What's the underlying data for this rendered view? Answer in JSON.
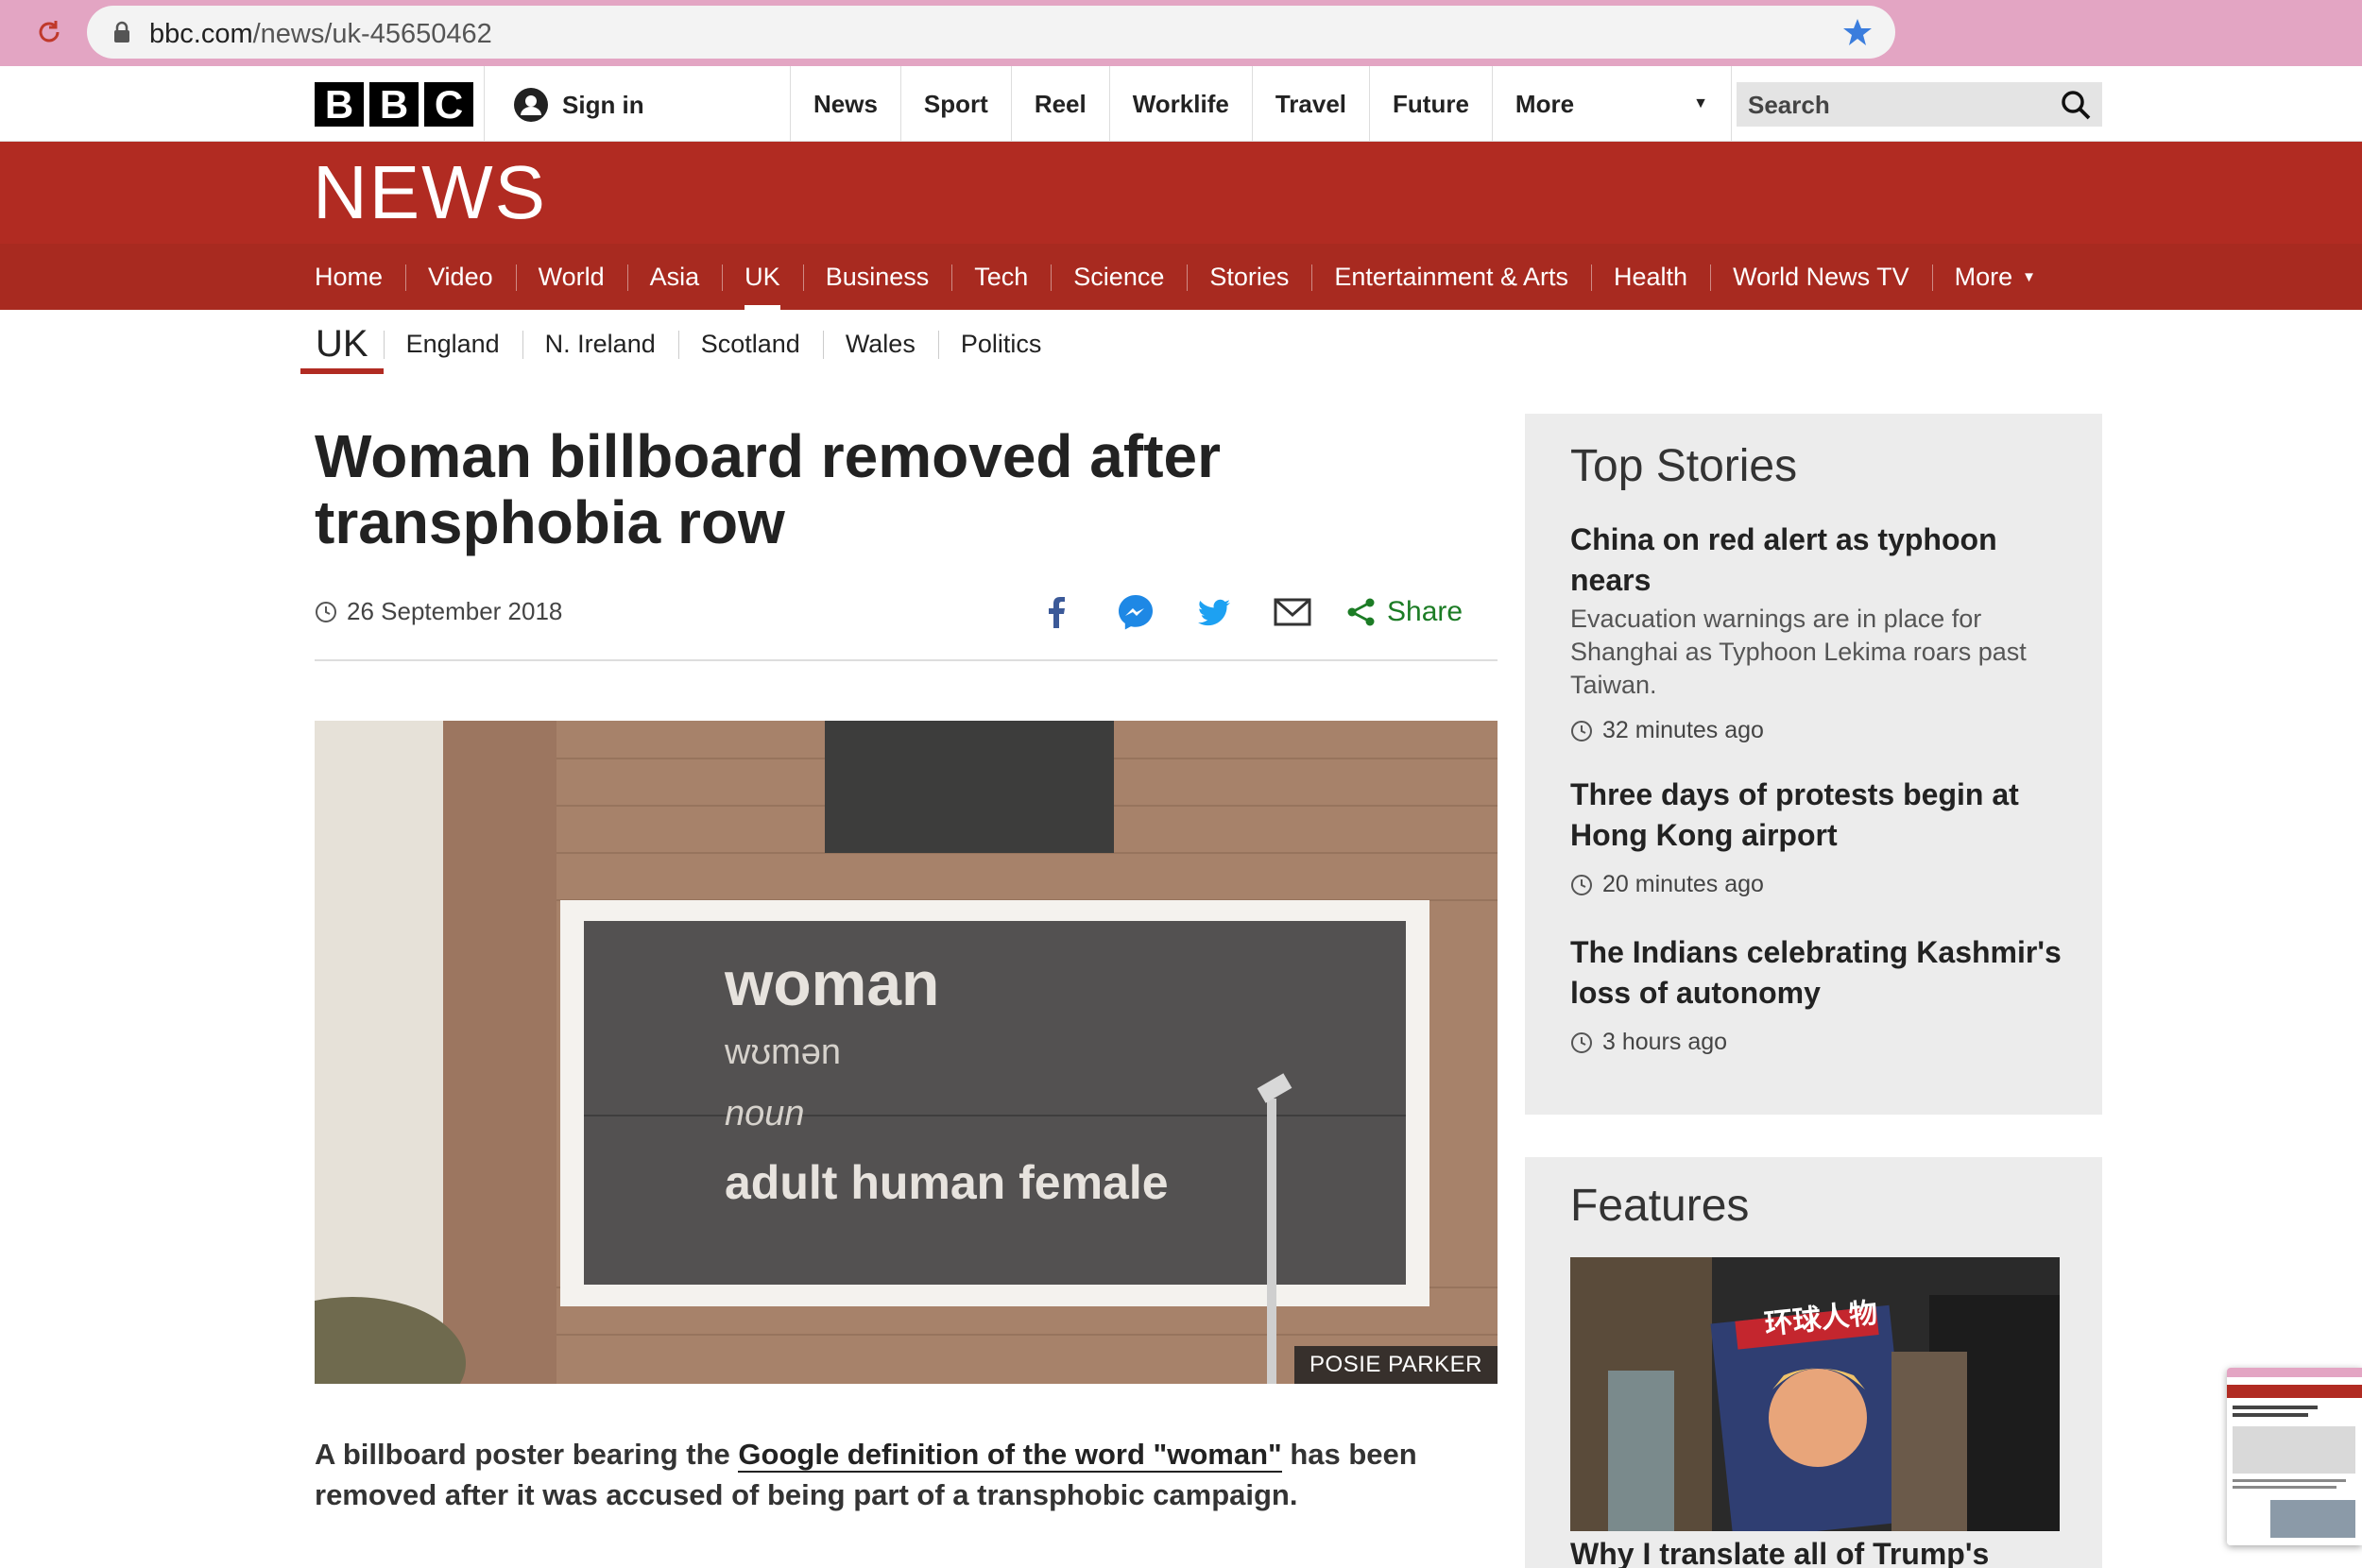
{
  "browser": {
    "url_host": "bbc.com",
    "url_path": "/news/uk-45650462"
  },
  "masthead": {
    "logo_letters": [
      "B",
      "B",
      "C"
    ],
    "signin_label": "Sign in",
    "nav": [
      "News",
      "Sport",
      "Reel",
      "Worklife",
      "Travel",
      "Future"
    ],
    "more_label": "More",
    "search_placeholder": "Search"
  },
  "news": {
    "banner_title": "NEWS",
    "nav": [
      {
        "label": "Home"
      },
      {
        "label": "Video"
      },
      {
        "label": "World"
      },
      {
        "label": "Asia"
      },
      {
        "label": "UK",
        "active": true
      },
      {
        "label": "Business"
      },
      {
        "label": "Tech"
      },
      {
        "label": "Science"
      },
      {
        "label": "Stories"
      },
      {
        "label": "Entertainment & Arts"
      },
      {
        "label": "Health"
      },
      {
        "label": "World News TV"
      }
    ],
    "nav_more": "More"
  },
  "sub_nav": {
    "section": "UK",
    "links": [
      "England",
      "N. Ireland",
      "Scotland",
      "Wales",
      "Politics"
    ]
  },
  "article": {
    "title": "Woman billboard removed after transphobia row",
    "date": "26 September 2018",
    "share_label": "Share",
    "image_caption": "POSIE PARKER",
    "billboard": {
      "line1": "woman",
      "line2": "wʊmən",
      "line3": "noun",
      "line4": "adult human female"
    },
    "lede_before": "A billboard poster bearing the ",
    "lede_link": "Google definition of the word \"woman\"",
    "lede_after": " has been removed after it was accused of being part of a transphobic campaign."
  },
  "sidebar": {
    "top_stories_heading": "Top Stories",
    "stories": [
      {
        "headline": "China on red alert as typhoon nears",
        "summary": "Evacuation warnings are in place for Shanghai as Typhoon Lekima roars past Taiwan.",
        "time": "32 minutes ago"
      },
      {
        "headline": "Three days of protests begin at Hong Kong airport",
        "summary": "",
        "time": "20 minutes ago"
      },
      {
        "headline": "The Indians celebrating Kashmir's loss of autonomy",
        "summary": "",
        "time": "3 hours ago"
      }
    ],
    "features_heading": "Features",
    "feature_headline": "Why I translate all of Trump's",
    "feature_magazine_title": "环球人物"
  },
  "colors": {
    "bbc_red": "#b12b22",
    "browser_bar": "#e3a5c3",
    "share_green": "#1c7c25",
    "sidebar_bg": "#ececec"
  }
}
